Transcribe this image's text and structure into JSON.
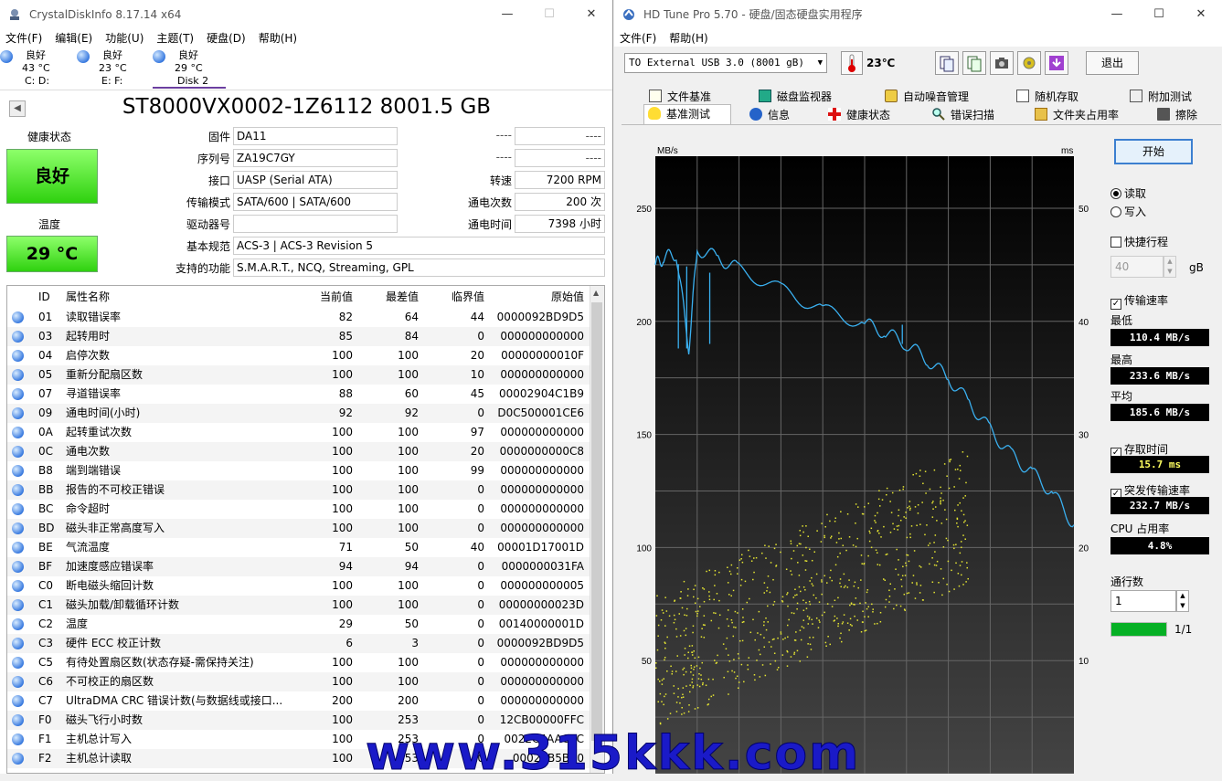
{
  "cdi": {
    "title": "CrystalDiskInfo 8.17.14 x64",
    "menu": [
      "文件(F)",
      "编辑(E)",
      "功能(U)",
      "主题(T)",
      "硬盘(D)",
      "帮助(H)"
    ],
    "disks": [
      {
        "status": "良好",
        "temp": "43 °C",
        "drive": "C: D:"
      },
      {
        "status": "良好",
        "temp": "23 °C",
        "drive": "E: F:"
      },
      {
        "status": "良好",
        "temp": "29 °C",
        "drive": "Disk 2"
      }
    ],
    "model": "ST8000VX0002-1Z6112 8001.5 GB",
    "health_label": "健康状态",
    "health_value": "良好",
    "temp_label": "温度",
    "temp_value": "29 °C",
    "firmware_label": "固件",
    "firmware": "DA11",
    "serial_label": "序列号",
    "serial": "ZA19C7GY",
    "interface_label": "接口",
    "interface": "UASP (Serial ATA)",
    "transfer_label": "传输模式",
    "transfer": "SATA/600 | SATA/600",
    "drive_letter_label": "驱动器号",
    "drive_letter": "",
    "standard_label": "基本规范",
    "standard": "ACS-3 | ACS-3 Revision 5",
    "features_label": "支持的功能",
    "features": "S.M.A.R.T., NCQ, Streaming, GPL",
    "dash1": "----",
    "dash1v": "----",
    "dash2": "----",
    "dash2v": "----",
    "rpm_label": "转速",
    "rpm": "7200 RPM",
    "power_count_label": "通电次数",
    "power_count": "200 次",
    "power_hours_label": "通电时间",
    "power_hours": "7398 小时",
    "headers": [
      "ID",
      "属性名称",
      "当前值",
      "最差值",
      "临界值",
      "原始值"
    ],
    "rows": [
      [
        "01",
        "读取错误率",
        "82",
        "64",
        "44",
        "0000092BD9D5"
      ],
      [
        "03",
        "起转用时",
        "85",
        "84",
        "0",
        "000000000000"
      ],
      [
        "04",
        "启停次数",
        "100",
        "100",
        "20",
        "00000000010F"
      ],
      [
        "05",
        "重新分配扇区数",
        "100",
        "100",
        "10",
        "000000000000"
      ],
      [
        "07",
        "寻道错误率",
        "88",
        "60",
        "45",
        "00002904C1B9"
      ],
      [
        "09",
        "通电时间(小时)",
        "92",
        "92",
        "0",
        "D0C500001CE6"
      ],
      [
        "0A",
        "起转重试次数",
        "100",
        "100",
        "97",
        "000000000000"
      ],
      [
        "0C",
        "通电次数",
        "100",
        "100",
        "20",
        "0000000000C8"
      ],
      [
        "B8",
        "端到端错误",
        "100",
        "100",
        "99",
        "000000000000"
      ],
      [
        "BB",
        "报告的不可校正错误",
        "100",
        "100",
        "0",
        "000000000000"
      ],
      [
        "BC",
        "命令超时",
        "100",
        "100",
        "0",
        "000000000000"
      ],
      [
        "BD",
        "磁头非正常高度写入",
        "100",
        "100",
        "0",
        "000000000000"
      ],
      [
        "BE",
        "气流温度",
        "71",
        "50",
        "40",
        "00001D17001D"
      ],
      [
        "BF",
        "加速度感应错误率",
        "94",
        "94",
        "0",
        "0000000031FA"
      ],
      [
        "C0",
        "断电磁头缩回计数",
        "100",
        "100",
        "0",
        "000000000005"
      ],
      [
        "C1",
        "磁头加载/卸载循环计数",
        "100",
        "100",
        "0",
        "00000000023D"
      ],
      [
        "C2",
        "温度",
        "29",
        "50",
        "0",
        "00140000001D"
      ],
      [
        "C3",
        "硬件 ECC 校正计数",
        "6",
        "3",
        "0",
        "0000092BD9D5"
      ],
      [
        "C5",
        "有待处置扇区数(状态存疑-需保持关注)",
        "100",
        "100",
        "0",
        "000000000000"
      ],
      [
        "C6",
        "不可校正的扇区数",
        "100",
        "100",
        "0",
        "000000000000"
      ],
      [
        "C7",
        "UltraDMA CRC 错误计数(与数据线或接口...",
        "200",
        "200",
        "0",
        "000000000000"
      ],
      [
        "F0",
        "磁头飞行小时数",
        "100",
        "253",
        "0",
        "12CB00000FFC"
      ],
      [
        "F1",
        "主机总计写入",
        "100",
        "253",
        "0",
        "0022C4AAC0C"
      ],
      [
        "F2",
        "主机总计读取",
        "100",
        "253",
        "0",
        "00028B5BB0"
      ]
    ]
  },
  "hdt": {
    "title": "HD Tune Pro 5.70 - 硬盘/固态硬盘实用程序",
    "menu": [
      "文件(F)",
      "帮助(H)"
    ],
    "drive": "TO External USB 3.0 (8001 gB)",
    "temp": "23℃",
    "exit": "退出",
    "tabs_top": [
      "文件基准",
      "磁盘监视器",
      "自动噪音管理",
      "随机存取",
      "附加测试"
    ],
    "tabs_bottom": [
      "基准测试",
      "信息",
      "健康状态",
      "错误扫描",
      "文件夹占用率",
      "擦除"
    ],
    "start": "开始",
    "read": "读取",
    "write": "写入",
    "short_stroke": "快捷行程",
    "stroke_value": "40",
    "stroke_unit": "gB",
    "transfer_rate": "传输速率",
    "min_label": "最低",
    "min": "110.4 MB/s",
    "max_label": "最高",
    "max": "233.6 MB/s",
    "avg_label": "平均",
    "avg": "185.6 MB/s",
    "access_time_label": "存取时间",
    "access_time": "15.7 ms",
    "burst_label": "突发传输速率",
    "burst": "232.7 MB/s",
    "cpu_label": "CPU 占用率",
    "cpu": "4.8%",
    "passes_label": "通行数",
    "passes": "1",
    "progress_text": "1/1",
    "progress": 1.0
  },
  "chart_data": {
    "type": "line",
    "ylabel": "MB/s",
    "y2label": "ms",
    "ylim": [
      0,
      250
    ],
    "y2lim": [
      0,
      50
    ],
    "yticks": [
      "250",
      "200",
      "150",
      "100",
      "50"
    ],
    "y2ticks": [
      "50",
      "40",
      "30",
      "20",
      "10"
    ],
    "grid": true,
    "series": [
      {
        "x": [
          0,
          0.02,
          0.05,
          0.08,
          0.1,
          0.15,
          0.2,
          0.3,
          0.4,
          0.5,
          0.55,
          0.6,
          0.65,
          0.7,
          0.75,
          0.8,
          0.85,
          0.9,
          0.95,
          1.0
        ],
        "values": [
          225,
          228,
          230,
          188,
          232,
          228,
          223,
          214,
          205,
          199,
          195,
          190,
          183,
          175,
          164,
          152,
          141,
          133,
          124,
          110
        ]
      }
    ],
    "access_scatter_ms": "yellow dots rising from ~10 to ~24 ms"
  },
  "watermark": "www.315kkk.com"
}
